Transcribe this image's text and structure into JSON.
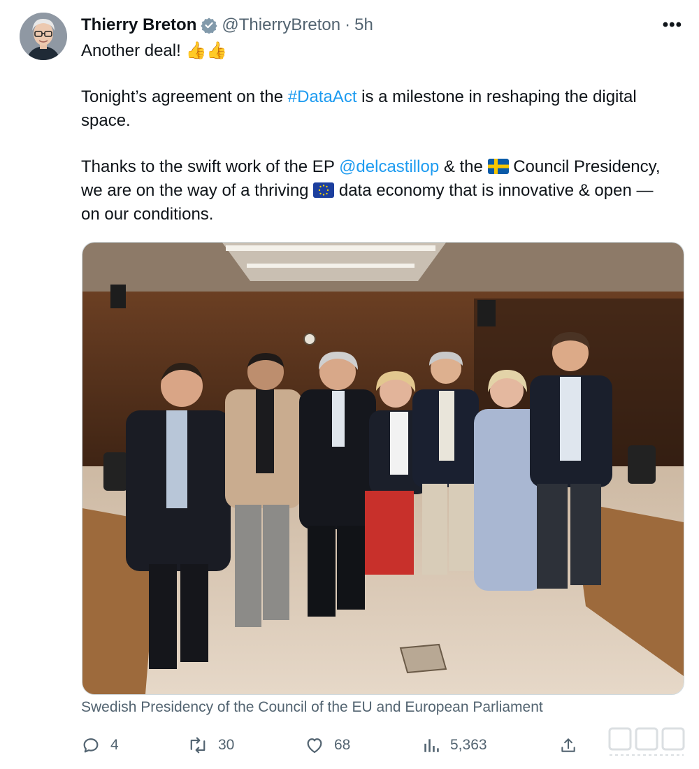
{
  "tweet": {
    "author_name": "Thierry Breton",
    "handle": "@ThierryBreton",
    "separator": "·",
    "time": "5h",
    "more_label": "•••",
    "line1": "Another deal!",
    "line1_emoji": "👍👍",
    "p2_before": "Tonight’s agreement on the ",
    "p2_hashtag": "#DataAct",
    "p2_after": " is a milestone in reshaping the digital space.",
    "p3_before": "Thanks to the swift work of the EP ",
    "p3_mention": "@delcastillop",
    "p3_mid": " & the ",
    "p3_after_flag": " Council Presidency, we are on the way of a thriving ",
    "p3_end": " data economy that is innovative & open — on our conditions.",
    "caption": "Swedish Presidency of the Council of the EU and European Parliament"
  },
  "actions": {
    "replies": "4",
    "retweets": "30",
    "likes": "68",
    "views": "5,363"
  },
  "colors": {
    "link": "#1d9bf0",
    "secondary": "#536471",
    "verified": "#829aab"
  },
  "icons": [
    "verified-badge-icon",
    "more-icon",
    "reply-icon",
    "retweet-icon",
    "like-icon",
    "views-icon",
    "share-icon",
    "sweden-flag-icon",
    "eu-flag-icon"
  ]
}
